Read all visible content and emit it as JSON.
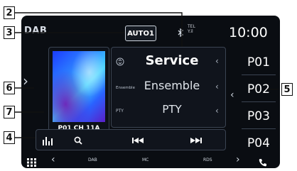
{
  "status": {
    "source": "DAB",
    "auto_button": "AUTO1",
    "tel_line1": "TEL",
    "tel_line2": "Y.il",
    "time": "10:00"
  },
  "artwork": {
    "caption": "P01  CH 11A"
  },
  "info": {
    "service": "Service",
    "ensemble_tag": "Ensemble",
    "ensemble": "Ensemble",
    "pty_tag": "PTY",
    "pty": "PTY"
  },
  "presets": [
    "P01",
    "P02",
    "P03",
    "P04"
  ],
  "bottom_bar": {
    "left": "DAB",
    "center": "MC",
    "right": "RDS"
  },
  "callouts": [
    "2",
    "3",
    "6",
    "7",
    "4",
    "5"
  ]
}
